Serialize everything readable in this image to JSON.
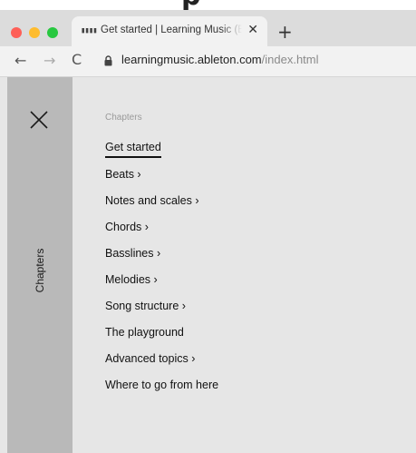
{
  "browser": {
    "tab": {
      "title": "Get started | Learning Music (Beta)",
      "favicon": "▮▮▮▮",
      "close": "✕"
    },
    "new_tab": "+",
    "nav": {
      "back": "←",
      "forward": "→",
      "reload": "C"
    },
    "url_host": "learningmusic.ableton.com",
    "url_path": "/index.html"
  },
  "sidebar": {
    "close": "close-x-icon",
    "label": "Chapters"
  },
  "menu": {
    "heading": "Chapters",
    "items": [
      {
        "label": "Get started",
        "active": true
      },
      {
        "label": "Beats ›"
      },
      {
        "label": "Notes and scales ›"
      },
      {
        "label": "Chords ›"
      },
      {
        "label": "Basslines ›"
      },
      {
        "label": "Melodies ›"
      },
      {
        "label": "Song structure ›"
      },
      {
        "label": "The playground"
      },
      {
        "label": "Advanced topics ›"
      },
      {
        "label": "Where to go from here"
      }
    ]
  },
  "colors": {
    "sidebar": "#b9b9b9",
    "page": "#e6e6e6",
    "tabbar": "#dcdcdc"
  }
}
